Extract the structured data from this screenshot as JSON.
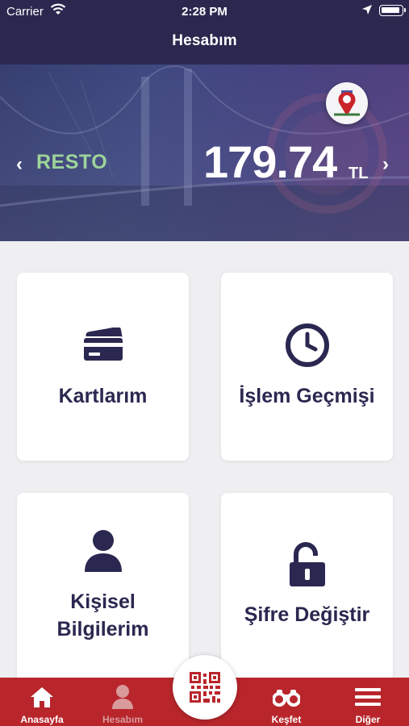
{
  "status_bar": {
    "carrier": "Carrier",
    "time": "2:28 PM",
    "icons": [
      "wifi-icon",
      "location-arrow-icon",
      "battery-icon"
    ]
  },
  "nav": {
    "title": "Hesabım"
  },
  "balance": {
    "card_type": "RESTO",
    "amount": "179.74",
    "currency": "TL",
    "prev_icon": "chevron-left-icon",
    "next_icon": "chevron-right-icon",
    "logo_icon": "map-pin-logo-icon"
  },
  "menu": [
    {
      "id": "cards",
      "label": "Kartlarım",
      "icon": "credit-card-icon"
    },
    {
      "id": "history",
      "label": "İşlem Geçmişi",
      "icon": "clock-icon"
    },
    {
      "id": "personal",
      "label_line1": "Kişisel",
      "label_line2": "Bilgilerim",
      "icon": "user-icon"
    },
    {
      "id": "password",
      "label": "Şifre Değiştir",
      "icon": "unlock-icon"
    }
  ],
  "tabbar": {
    "items": [
      {
        "label": "Anasayfa",
        "icon": "home-icon",
        "active": false
      },
      {
        "label": "Hesabım",
        "icon": "person-icon",
        "active": true
      },
      {
        "label": "Keşfet",
        "icon": "binoculars-icon",
        "active": false
      },
      {
        "label": "Diğer",
        "icon": "hamburger-icon",
        "active": false
      }
    ],
    "center_icon": "qr-code-icon"
  },
  "colors": {
    "nav_bg": "#2b2850",
    "accent_red": "#b8262b",
    "card_type_green": "#9dd49a",
    "tile_text": "#2a2850",
    "background": "#efeff1"
  }
}
